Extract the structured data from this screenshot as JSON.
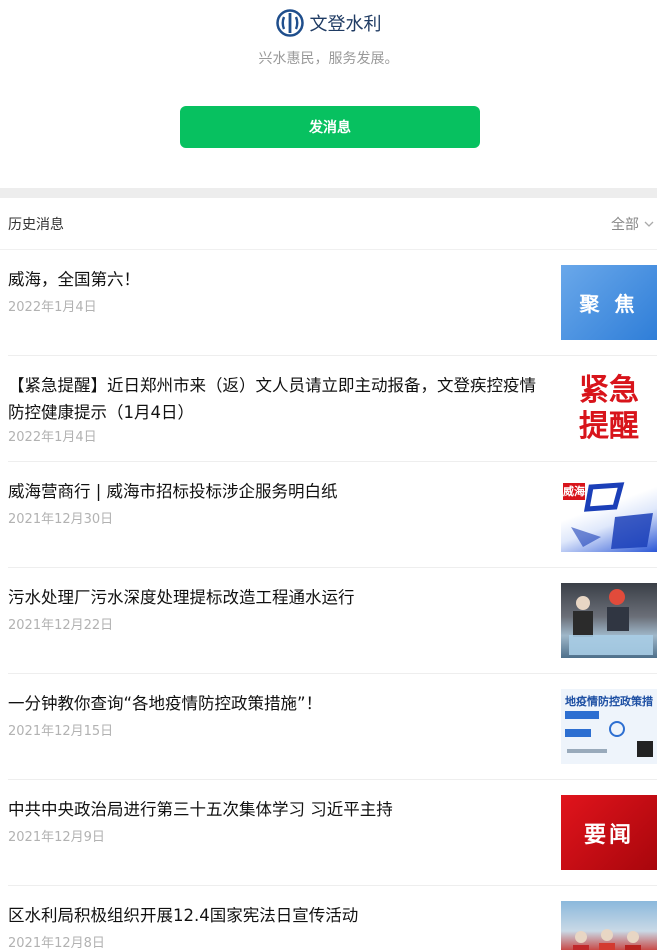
{
  "account": {
    "name": "文登水利",
    "slogan": "兴水惠民，服务发展。",
    "logo_icon": "water-conservancy-logo-icon",
    "brand_color": "#1f4e8c"
  },
  "send_button": {
    "label": "发消息",
    "color": "#07c160"
  },
  "history": {
    "title": "历史消息",
    "filter_label": "全部",
    "filter_icon": "chevron-down-icon"
  },
  "articles": [
    {
      "title": "威海，全国第六！",
      "date": "2022年1月4日",
      "thumb_text": "聚 焦"
    },
    {
      "title": "【紧急提醒】近日郑州市来（返）文人员请立即主动报备，文登疾控疫情防控健康提示（1月4日）",
      "date": "2022年1月4日",
      "thumb_text": "紧急提醒"
    },
    {
      "title": "威海营商行 | 威海市招标投标涉企服务明白纸",
      "date": "2021年12月30日",
      "thumb_text": "威海"
    },
    {
      "title": "污水处理厂污水深度处理提标改造工程通水运行",
      "date": "2021年12月22日",
      "thumb_text": ""
    },
    {
      "title": "一分钟教你查询“各地疫情防控政策措施”！",
      "date": "2021年12月15日",
      "thumb_text": "地疫情防控政策措"
    },
    {
      "title": "中共中央政治局进行第三十五次集体学习 习近平主持",
      "date": "2021年12月9日",
      "thumb_text": "要闻"
    },
    {
      "title": "区水利局积极组织开展12.4国家宪法日宣传活动",
      "date": "2021年12月8日",
      "thumb_text": ""
    }
  ]
}
